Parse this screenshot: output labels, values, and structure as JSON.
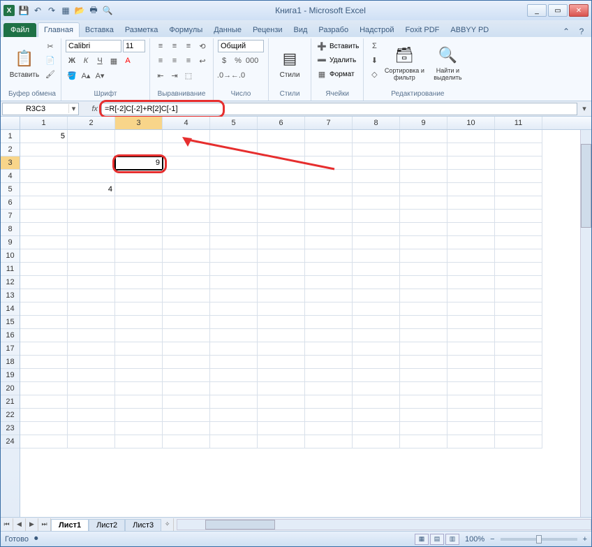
{
  "window": {
    "title": "Книга1 - Microsoft Excel",
    "min": "_",
    "max": "▭",
    "close": "✕"
  },
  "qat": {
    "save": "💾",
    "undo": "↶",
    "redo": "↷",
    "new": "▦",
    "open": "📂",
    "print": "🖶",
    "preview": "🔍"
  },
  "tabs": {
    "file": "Файл",
    "items": [
      "Главная",
      "Вставка",
      "Разметка",
      "Формулы",
      "Данные",
      "Рецензи",
      "Вид",
      "Разрабо",
      "Надстрой",
      "Foxit PDF",
      "ABBYY PD"
    ],
    "active": 0
  },
  "ribbon": {
    "clipboard": {
      "paste": "Вставить",
      "label": "Буфер обмена",
      "cut": "✂",
      "copy": "📄",
      "brush": "🖌"
    },
    "font": {
      "name": "Calibri",
      "size": "11",
      "label": "Шрифт",
      "bold": "Ж",
      "italic": "К",
      "underline": "Ч"
    },
    "align": {
      "label": "Выравнивание"
    },
    "number": {
      "label": "Число",
      "format": "Общий"
    },
    "styles": {
      "label": "Стили",
      "btn": "Стили"
    },
    "cells": {
      "label": "Ячейки",
      "insert": "Вставить",
      "delete": "Удалить",
      "format": "Формат"
    },
    "editing": {
      "label": "Редактирование",
      "sort": "Сортировка и фильтр",
      "find": "Найти и выделить",
      "sum": "Σ",
      "fill": "⬇",
      "clear": "◇"
    }
  },
  "formula_bar": {
    "name_box": "R3C3",
    "fx": "fx",
    "formula": "=R[-2]C[-2]+R[2]C[-1]"
  },
  "grid": {
    "columns": [
      "1",
      "2",
      "3",
      "4",
      "5",
      "6",
      "7",
      "8",
      "9",
      "10",
      "11"
    ],
    "rows": [
      "1",
      "2",
      "3",
      "4",
      "5",
      "6",
      "7",
      "8",
      "9",
      "10",
      "11",
      "12",
      "13",
      "14",
      "15",
      "16",
      "17",
      "18",
      "19",
      "20",
      "21",
      "22",
      "23",
      "24"
    ],
    "selected_col": 2,
    "selected_row": 2,
    "cells": {
      "r1c1": "5",
      "r3c3": "9",
      "r5c2": "4"
    }
  },
  "sheets": {
    "items": [
      "Лист1",
      "Лист2",
      "Лист3"
    ],
    "active": 0
  },
  "status": {
    "ready": "Готово",
    "zoom": "100%",
    "minus": "−",
    "plus": "+"
  }
}
